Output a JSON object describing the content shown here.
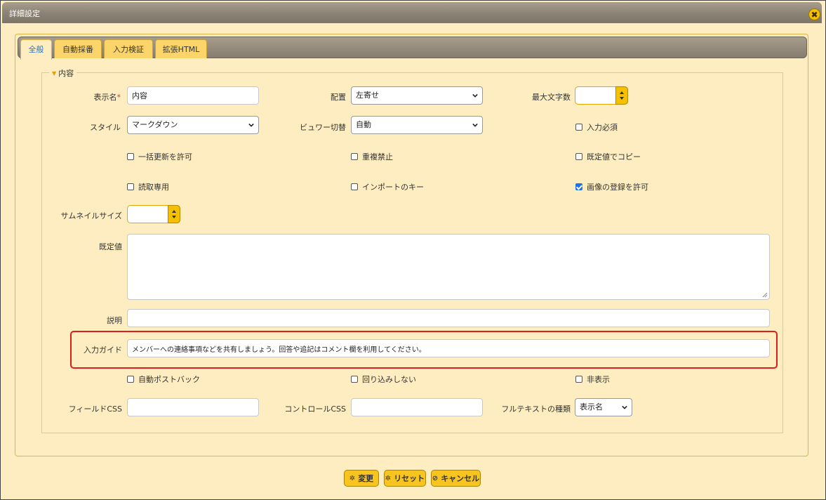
{
  "window": {
    "title": "詳細設定",
    "close_glyph": "✖"
  },
  "tabs": [
    {
      "label": "全般",
      "active": true
    },
    {
      "label": "自動採番",
      "active": false
    },
    {
      "label": "入力検証",
      "active": false
    },
    {
      "label": "拡張HTML",
      "active": false
    }
  ],
  "section": {
    "legend": "内容",
    "arrow_glyph": "▼"
  },
  "fields": {
    "display_name": {
      "label": "表示名",
      "required_mark": "*",
      "value": "内容"
    },
    "align": {
      "label": "配置",
      "value": "左寄せ"
    },
    "max_length": {
      "label": "最大文字数",
      "value": ""
    },
    "style": {
      "label": "スタイル",
      "value": "マークダウン"
    },
    "viewer_switch": {
      "label": "ビュワー切替",
      "value": "自動"
    },
    "thumbnail_size": {
      "label": "サムネイルサイズ",
      "value": ""
    },
    "default_value": {
      "label": "既定値",
      "value": ""
    },
    "description": {
      "label": "説明",
      "value": ""
    },
    "input_guide": {
      "label": "入力ガイド",
      "value": "メンバーへの連絡事項などを共有しましょう。回答や追記はコメント欄を利用してください。"
    },
    "field_css": {
      "label": "フィールドCSS",
      "value": ""
    },
    "control_css": {
      "label": "コントロールCSS",
      "value": ""
    },
    "fulltext_type": {
      "label": "フルテキストの種類",
      "value": "表示名"
    }
  },
  "checkboxes": {
    "required": {
      "label": "入力必須",
      "checked": false
    },
    "bulk_update": {
      "label": "一括更新を許可",
      "checked": false
    },
    "no_duplicate": {
      "label": "重複禁止",
      "checked": false
    },
    "copy_default": {
      "label": "既定値でコピー",
      "checked": false
    },
    "readonly": {
      "label": "読取専用",
      "checked": false
    },
    "import_key": {
      "label": "インポートのキー",
      "checked": false
    },
    "allow_images": {
      "label": "画像の登録を許可",
      "checked": true
    },
    "auto_postback": {
      "label": "自動ポストバック",
      "checked": false
    },
    "no_wrap": {
      "label": "回り込みしない",
      "checked": false
    },
    "hidden": {
      "label": "非表示",
      "checked": false
    }
  },
  "buttons": {
    "change": {
      "label": "変更",
      "icon": "gear-icon",
      "glyph": "✲"
    },
    "reset": {
      "label": "リセット",
      "icon": "gear-icon",
      "glyph": "✲"
    },
    "cancel": {
      "label": "キャンセル",
      "icon": "prohibit-icon",
      "glyph": "⊘"
    }
  },
  "colors": {
    "accent": "#f8c520",
    "highlight": "#e01b1b",
    "panel": "#fdedc0",
    "active_tab_text": "#2f74b5",
    "checkbox_on": "#1a73e8"
  }
}
